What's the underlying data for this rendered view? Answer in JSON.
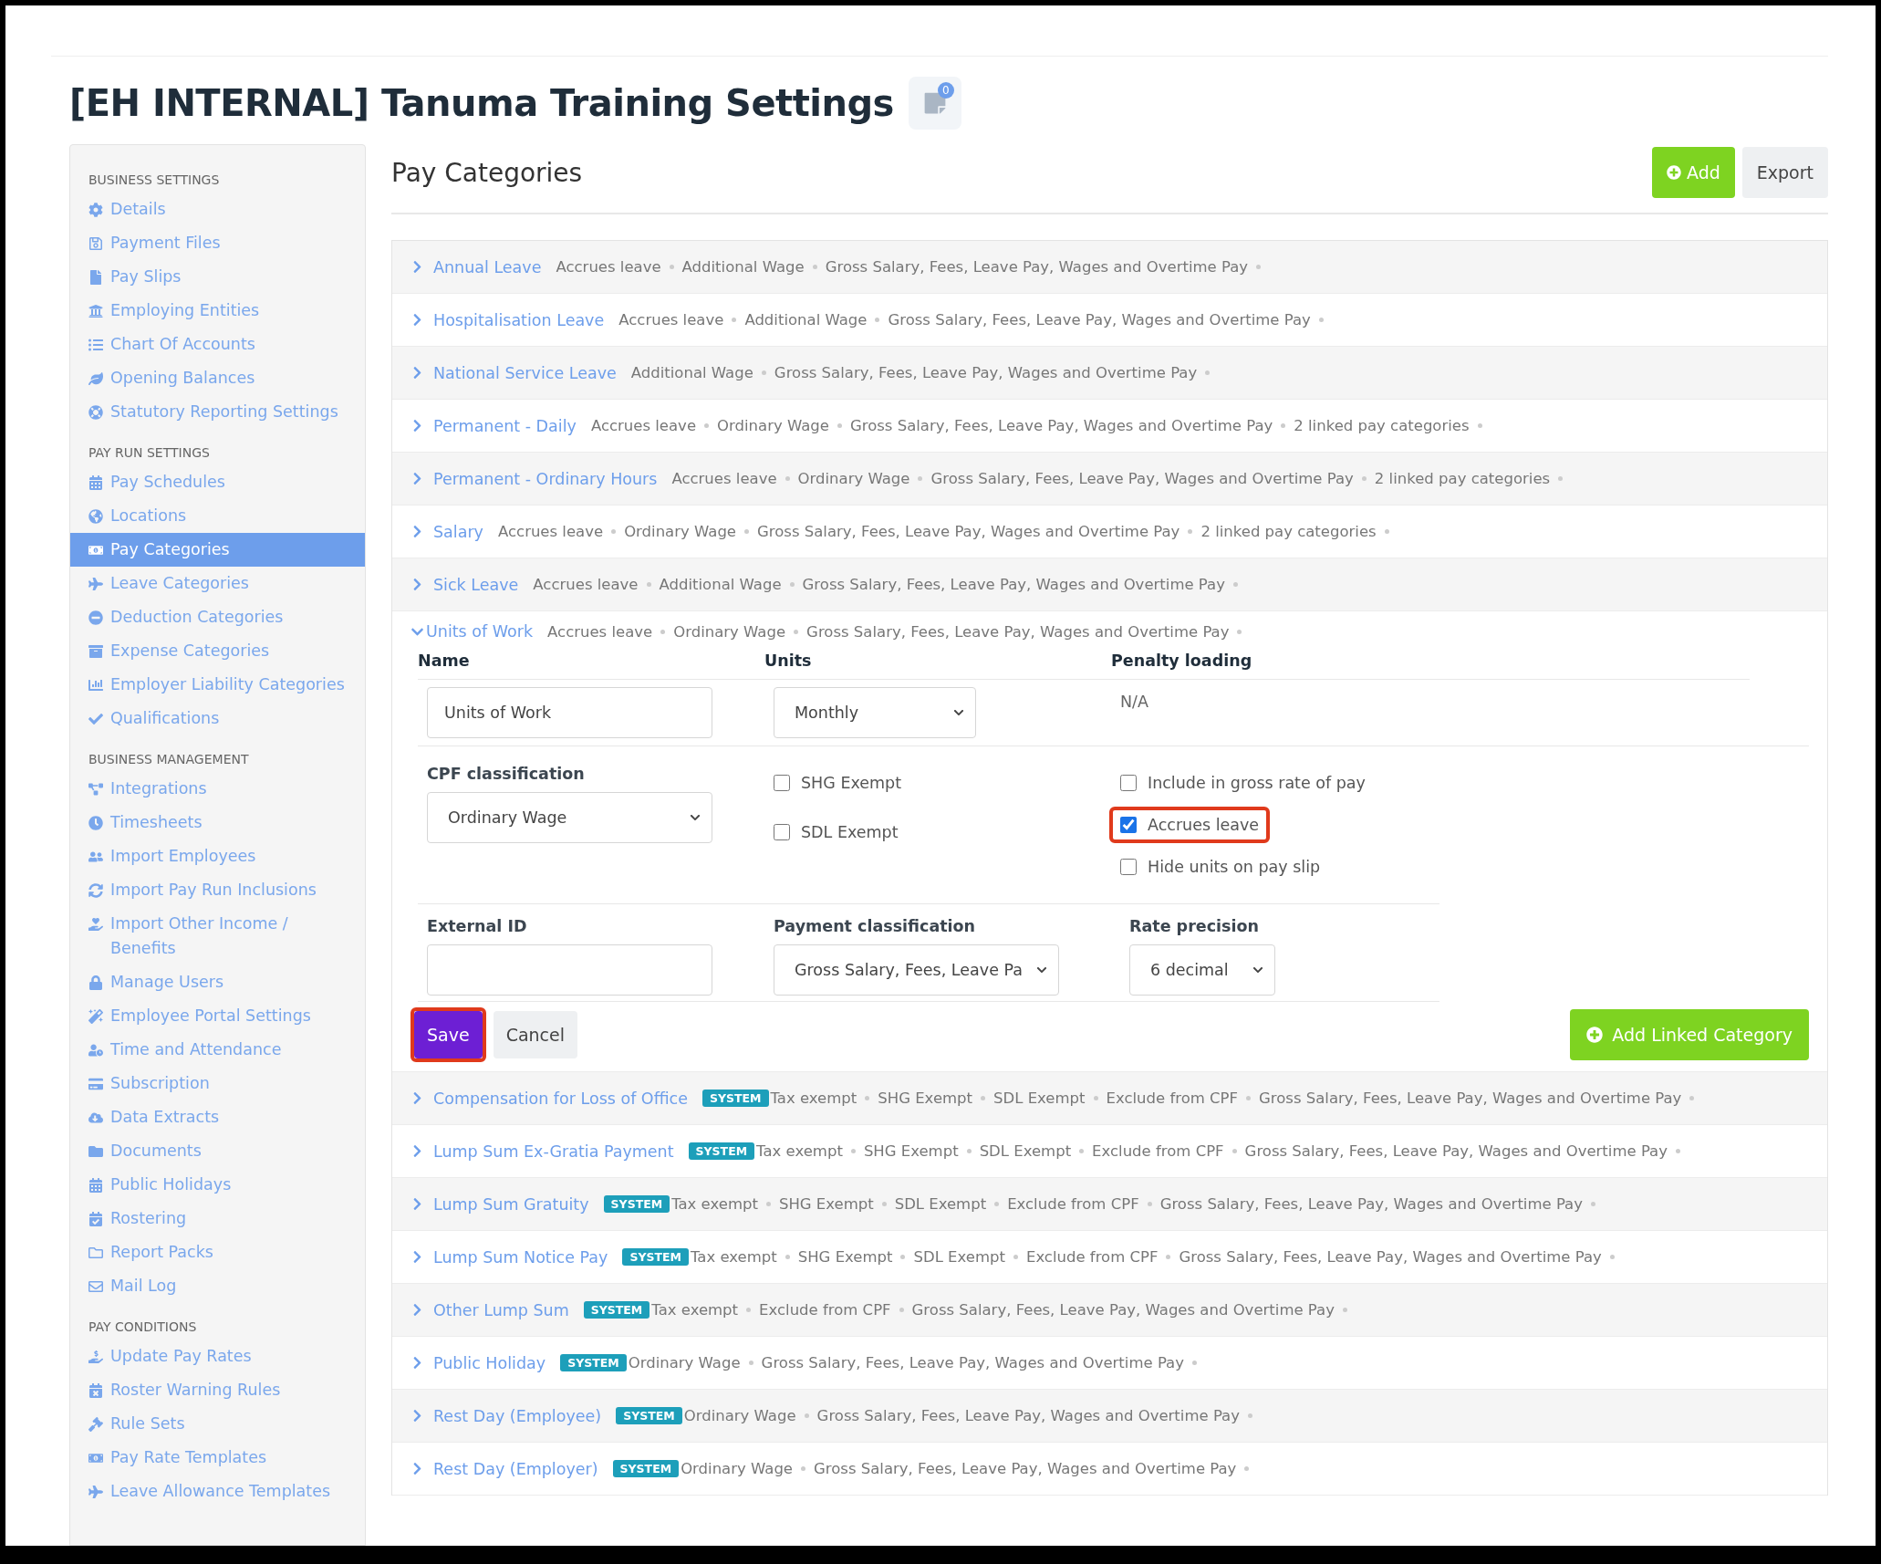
{
  "page": {
    "title": "[EH INTERNAL] Tanuma Training Settings",
    "notes_badge": "0"
  },
  "sidebar": {
    "sections": [
      {
        "heading": "BUSINESS SETTINGS",
        "items": [
          {
            "label": "Details",
            "selected": false
          },
          {
            "label": "Payment Files",
            "selected": false
          },
          {
            "label": "Pay Slips",
            "selected": false
          },
          {
            "label": "Employing Entities",
            "selected": false
          },
          {
            "label": "Chart Of Accounts",
            "selected": false
          },
          {
            "label": "Opening Balances",
            "selected": false
          },
          {
            "label": "Statutory Reporting Settings",
            "selected": false
          }
        ]
      },
      {
        "heading": "PAY RUN SETTINGS",
        "items": [
          {
            "label": "Pay Schedules",
            "selected": false
          },
          {
            "label": "Locations",
            "selected": false
          },
          {
            "label": "Pay Categories",
            "selected": true
          },
          {
            "label": "Leave Categories",
            "selected": false
          },
          {
            "label": "Deduction Categories",
            "selected": false
          },
          {
            "label": "Expense Categories",
            "selected": false
          },
          {
            "label": "Employer Liability Categories",
            "selected": false
          },
          {
            "label": "Qualifications",
            "selected": false
          }
        ]
      },
      {
        "heading": "BUSINESS MANAGEMENT",
        "items": [
          {
            "label": "Integrations",
            "selected": false
          },
          {
            "label": "Timesheets",
            "selected": false
          },
          {
            "label": "Import Employees",
            "selected": false
          },
          {
            "label": "Import Pay Run Inclusions",
            "selected": false
          },
          {
            "label": "Import Other Income / Benefits",
            "selected": false
          },
          {
            "label": "Manage Users",
            "selected": false
          },
          {
            "label": "Employee Portal Settings",
            "selected": false
          },
          {
            "label": "Time and Attendance",
            "selected": false
          },
          {
            "label": "Subscription",
            "selected": false
          },
          {
            "label": "Data Extracts",
            "selected": false
          },
          {
            "label": "Documents",
            "selected": false
          },
          {
            "label": "Public Holidays",
            "selected": false
          },
          {
            "label": "Rostering",
            "selected": false
          },
          {
            "label": "Report Packs",
            "selected": false
          },
          {
            "label": "Mail Log",
            "selected": false
          }
        ]
      },
      {
        "heading": "PAY CONDITIONS",
        "items": [
          {
            "label": "Update Pay Rates",
            "selected": false
          },
          {
            "label": "Roster Warning Rules",
            "selected": false
          },
          {
            "label": "Rule Sets",
            "selected": false
          },
          {
            "label": "Pay Rate Templates",
            "selected": false
          },
          {
            "label": "Leave Allowance Templates",
            "selected": false
          }
        ]
      }
    ]
  },
  "main": {
    "heading": "Pay Categories",
    "buttons": [
      {
        "label": "Add",
        "kind": "primary"
      },
      {
        "label": "Export",
        "kind": "default"
      }
    ],
    "categories": [
      {
        "name": "Annual Leave",
        "expanded": false,
        "system": false,
        "attributes": [
          "Accrues leave",
          "Additional Wage",
          "Gross Salary, Fees, Leave Pay, Wages and Overtime Pay"
        ]
      },
      {
        "name": "Hospitalisation Leave",
        "expanded": false,
        "system": false,
        "attributes": [
          "Accrues leave",
          "Additional Wage",
          "Gross Salary, Fees, Leave Pay, Wages and Overtime Pay"
        ]
      },
      {
        "name": "National Service Leave",
        "expanded": false,
        "system": false,
        "attributes": [
          "Additional Wage",
          "Gross Salary, Fees, Leave Pay, Wages and Overtime Pay"
        ]
      },
      {
        "name": "Permanent - Daily",
        "expanded": false,
        "system": false,
        "attributes": [
          "Accrues leave",
          "Ordinary Wage",
          "Gross Salary, Fees, Leave Pay, Wages and Overtime Pay",
          "2 linked pay categories"
        ]
      },
      {
        "name": "Permanent - Ordinary Hours",
        "expanded": false,
        "system": false,
        "attributes": [
          "Accrues leave",
          "Ordinary Wage",
          "Gross Salary, Fees, Leave Pay, Wages and Overtime Pay",
          "2 linked pay categories"
        ]
      },
      {
        "name": "Salary",
        "expanded": false,
        "system": false,
        "attributes": [
          "Accrues leave",
          "Ordinary Wage",
          "Gross Salary, Fees, Leave Pay, Wages and Overtime Pay",
          "2 linked pay categories"
        ]
      },
      {
        "name": "Sick Leave",
        "expanded": false,
        "system": false,
        "attributes": [
          "Accrues leave",
          "Additional Wage",
          "Gross Salary, Fees, Leave Pay, Wages and Overtime Pay"
        ]
      },
      {
        "name": "Units of Work",
        "expanded": true,
        "system": false,
        "attributes": [
          "Accrues leave",
          "Ordinary Wage",
          "Gross Salary, Fees, Leave Pay, Wages and Overtime Pay"
        ],
        "form": {
          "name": {
            "label": "Name",
            "value": "Units of Work"
          },
          "units": {
            "label": "Units",
            "value": "Monthly"
          },
          "penalty_loading": {
            "label": "Penalty loading",
            "value": "N/A"
          },
          "cpf_classification": {
            "label": "CPF classification",
            "value": "Ordinary Wage"
          },
          "exemptions": [
            {
              "label": "SHG Exempt",
              "checked": false,
              "highlighted": false
            },
            {
              "label": "SDL Exempt",
              "checked": false,
              "highlighted": false
            }
          ],
          "options": [
            {
              "label": "Include in gross rate of pay",
              "checked": false,
              "highlighted": false
            },
            {
              "label": "Accrues leave",
              "checked": true,
              "highlighted": true
            },
            {
              "label": "Hide units on pay slip",
              "checked": false,
              "highlighted": false
            }
          ],
          "external_id": {
            "label": "External ID"
          },
          "payment_classification": {
            "label": "Payment classification",
            "value": "Gross Salary, Fees, Leave Pa"
          },
          "rate_precision": {
            "label": "Rate precision",
            "value": "6 decimal"
          },
          "actions": [
            {
              "label": "Save",
              "kind": "save",
              "highlighted": true
            },
            {
              "label": "Cancel",
              "kind": "cancel",
              "highlighted": false
            }
          ],
          "add_linked": "Add Linked Category"
        }
      },
      {
        "name": "Compensation for Loss of Office",
        "expanded": false,
        "system": true,
        "badge": "SYSTEM",
        "attributes": [
          "Tax exempt",
          "SHG Exempt",
          "SDL Exempt",
          "Exclude from CPF",
          "Gross Salary, Fees, Leave Pay, Wages and Overtime Pay"
        ]
      },
      {
        "name": "Lump Sum Ex-Gratia Payment",
        "expanded": false,
        "system": true,
        "badge": "SYSTEM",
        "attributes": [
          "Tax exempt",
          "SHG Exempt",
          "SDL Exempt",
          "Exclude from CPF",
          "Gross Salary, Fees, Leave Pay, Wages and Overtime Pay"
        ]
      },
      {
        "name": "Lump Sum Gratuity",
        "expanded": false,
        "system": true,
        "badge": "SYSTEM",
        "attributes": [
          "Tax exempt",
          "SHG Exempt",
          "SDL Exempt",
          "Exclude from CPF",
          "Gross Salary, Fees, Leave Pay, Wages and Overtime Pay"
        ]
      },
      {
        "name": "Lump Sum Notice Pay",
        "expanded": false,
        "system": true,
        "badge": "SYSTEM",
        "attributes": [
          "Tax exempt",
          "SHG Exempt",
          "SDL Exempt",
          "Exclude from CPF",
          "Gross Salary, Fees, Leave Pay, Wages and Overtime Pay"
        ]
      },
      {
        "name": "Other Lump Sum",
        "expanded": false,
        "system": true,
        "badge": "SYSTEM",
        "attributes": [
          "Tax exempt",
          "Exclude from CPF",
          "Gross Salary, Fees, Leave Pay, Wages and Overtime Pay"
        ]
      },
      {
        "name": "Public Holiday",
        "expanded": false,
        "system": true,
        "badge": "SYSTEM",
        "attributes": [
          "Ordinary Wage",
          "Gross Salary, Fees, Leave Pay, Wages and Overtime Pay"
        ]
      },
      {
        "name": "Rest Day (Employee)",
        "expanded": false,
        "system": true,
        "badge": "SYSTEM",
        "attributes": [
          "Ordinary Wage",
          "Gross Salary, Fees, Leave Pay, Wages and Overtime Pay"
        ]
      },
      {
        "name": "Rest Day (Employer)",
        "expanded": false,
        "system": true,
        "badge": "SYSTEM",
        "attributes": [
          "Ordinary Wage",
          "Gross Salary, Fees, Leave Pay, Wages and Overtime Pay"
        ]
      }
    ]
  }
}
